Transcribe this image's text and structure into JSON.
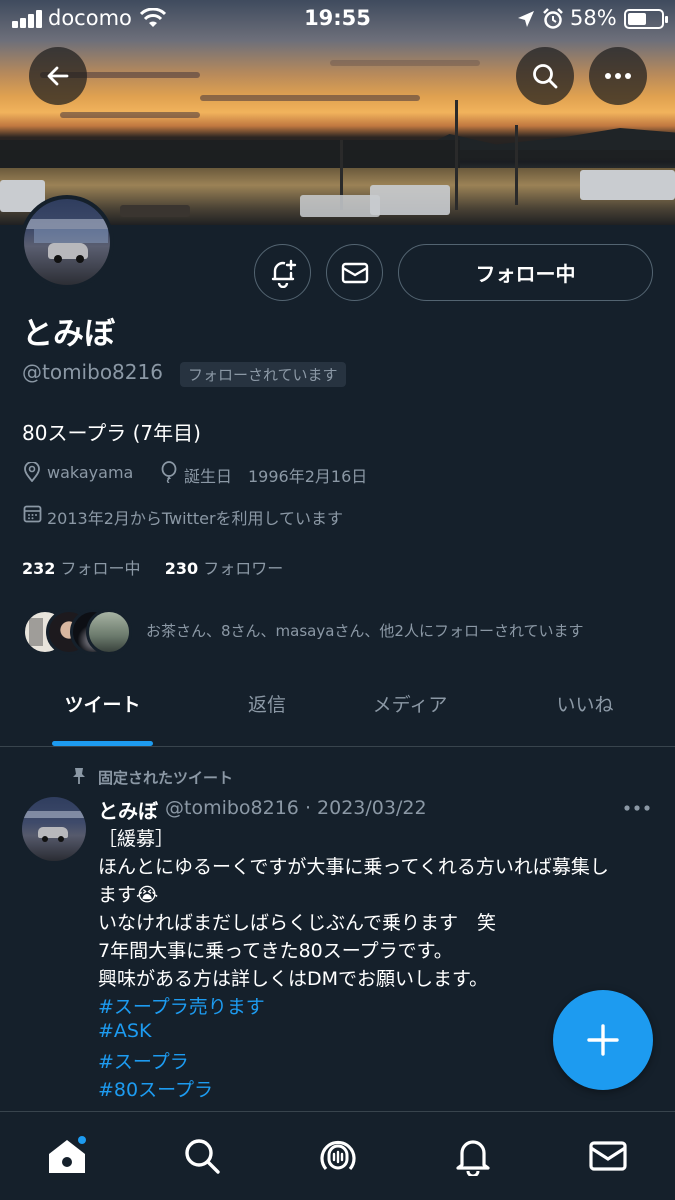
{
  "status_bar": {
    "carrier": "docomo",
    "time": "19:55",
    "battery": "58%"
  },
  "profile": {
    "name": "とみぼ",
    "handle": "@tomibo8216",
    "follows_you": "フォローされています",
    "bio": "80スープラ (7年目)",
    "location": "wakayama",
    "birthday": "誕生日　1996年2月16日",
    "joined": "2013年2月からTwitterを利用しています",
    "following_count": "232",
    "following_label": "フォロー中",
    "followers_count": "230",
    "followers_label": "フォロワー",
    "followed_by": "お茶さん、8さん、masayaさん、他2人にフォローされています"
  },
  "actions": {
    "follow_button": "フォロー中"
  },
  "tabs": [
    {
      "label": "ツイート"
    },
    {
      "label": "返信"
    },
    {
      "label": "メディア"
    },
    {
      "label": "いいね"
    }
  ],
  "tweet": {
    "pinned_label": "固定されたツイート",
    "name": "とみぼ",
    "meta": "@tomibo8216 · 2023/03/22",
    "lines": [
      "［緩募］",
      "ほんとにゆるーくですが大事に乗ってくれる方いれば募集し",
      "ます😭",
      "いなければまだしばらくじぶんで乗ります　笑",
      "7年間大事に乗ってきた80スープラです。",
      "興味がある方は詳しくはDMでお願いします。"
    ],
    "hashtags": [
      "#スープラ売ります",
      "#ASK",
      "#スープラ",
      "#80スープラ"
    ]
  },
  "icons": {
    "back": "back-arrow-icon",
    "search": "search-icon",
    "more": "more-icon",
    "notify": "notification-bell-plus-icon",
    "message": "envelope-icon",
    "fab": "compose-plus-icon"
  },
  "colors": {
    "background": "#15202b",
    "accent": "#1d9bf0",
    "secondary_text": "#8b98a5"
  }
}
